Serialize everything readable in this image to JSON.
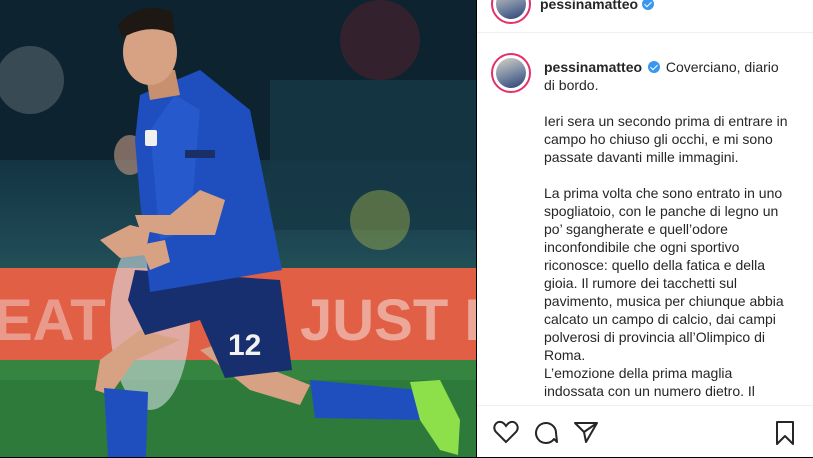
{
  "post": {
    "username": "pessinamatteo",
    "caption_first_line": "Coverciano, diario di bordo.",
    "caption_paragraphs": [
      "Ieri sera un secondo prima di entrare in campo ho chiuso gli occhi, e mi sono passate davanti mille immagini.",
      "La prima volta che sono entrato in uno spogliatoio, con le panche di legno un po’ sgangherate e quell’odore inconfondibile che ogni sportivo riconosce: quello della fatica e della gioia. Il rumore dei tacchetti sul pavimento, musica per chiunque abbia calcato un campo di calcio, dai campi polverosi di provincia all’Olimpico di Roma.\nL’emozione della prima maglia indossata con un numero dietro. Il"
    ]
  },
  "photo": {
    "jersey_number": "12",
    "ad_board_text": "JUST EA",
    "left_ad_text": "EAT"
  },
  "icons": {
    "like": "heart-icon",
    "comment": "comment-icon",
    "share": "share-icon",
    "save": "bookmark-icon",
    "verified": "verified-badge-icon"
  },
  "colors": {
    "jersey": "#1f4fbf",
    "verified": "#3897f0",
    "ad_board": "#e0553a",
    "pitch": "#2e7a3a"
  }
}
